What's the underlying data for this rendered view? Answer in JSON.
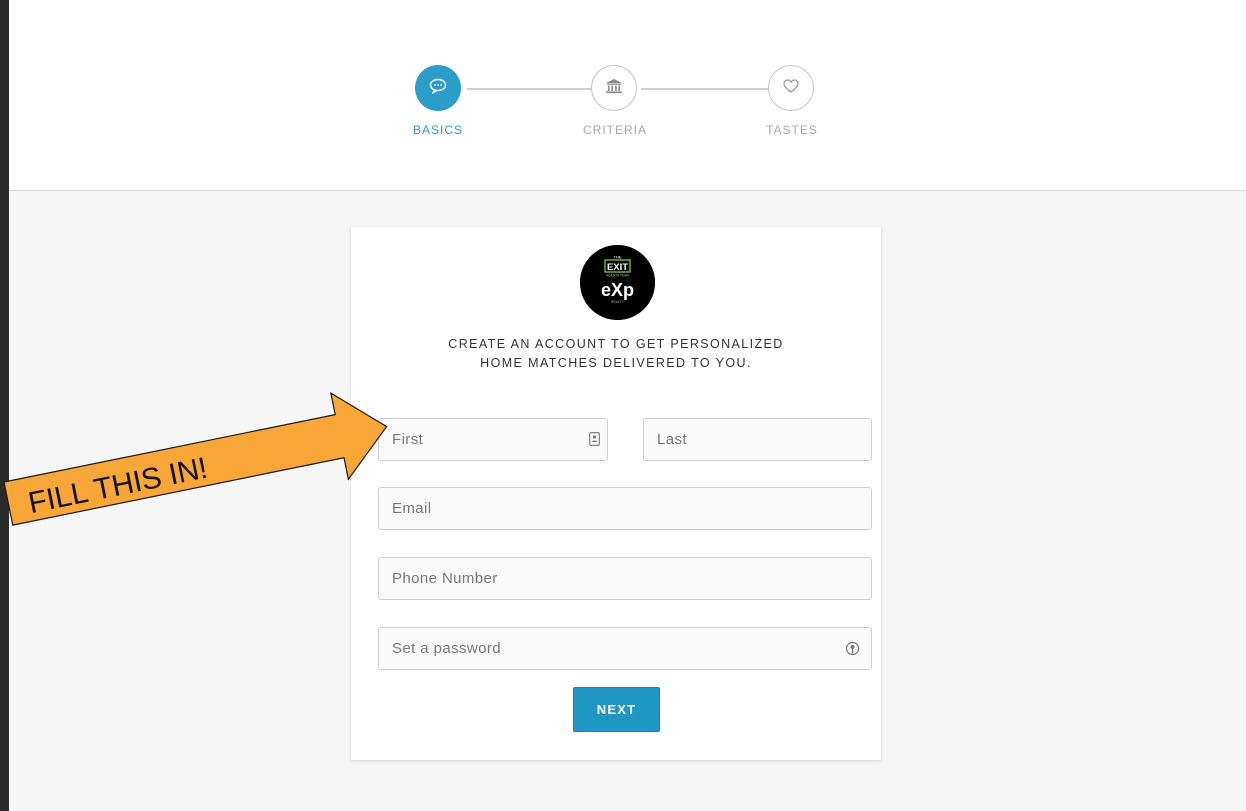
{
  "steps": [
    {
      "label": "BASICS",
      "icon": "chat-bubble-icon",
      "active": true
    },
    {
      "label": "CRITERIA",
      "icon": "bank-icon",
      "active": false
    },
    {
      "label": "TASTES",
      "icon": "heart-icon",
      "active": false
    }
  ],
  "logo": {
    "top_text": "THE",
    "brand": "EXIT",
    "sub_text": "AGENTS TEAM",
    "mark": "eXp",
    "bottom_text": "REALTY"
  },
  "intro": {
    "line1": "CREATE AN ACCOUNT TO GET PERSONALIZED",
    "line2": "HOME MATCHES DELIVERED TO YOU."
  },
  "form": {
    "first_placeholder": "First",
    "last_placeholder": "Last",
    "email_placeholder": "Email",
    "phone_placeholder": "Phone Number",
    "password_placeholder": "Set a password",
    "next_label": "NEXT"
  },
  "annotation": {
    "text": "FILL THIS IN!",
    "color": "#f9a638"
  },
  "colors": {
    "accent": "#2a9ec8",
    "button": "#1f97c3",
    "background": "#f6f6f6"
  }
}
